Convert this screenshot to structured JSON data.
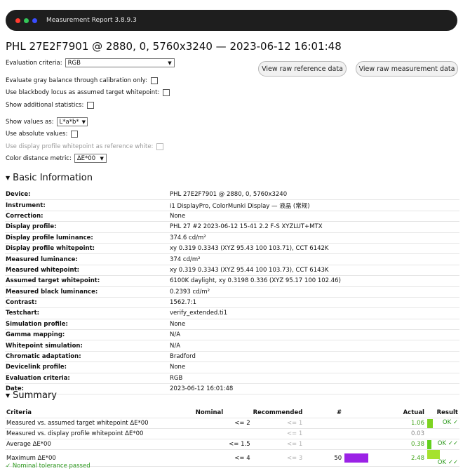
{
  "window": {
    "title": "Measurement Report 3.8.9.3",
    "controls": [
      {
        "name": "close",
        "color": "#ff3b30"
      },
      {
        "name": "minimize",
        "color": "#34c759"
      },
      {
        "name": "maximize",
        "color": "#3a4dff"
      }
    ]
  },
  "heading": "PHL 27E2F7901 @ 2880, 0, 5760x3240 — 2023-06-12 16:01:48",
  "buttons": {
    "raw_reference": "View raw reference data",
    "raw_measurement": "View raw measurement data"
  },
  "options": {
    "evaluation_criteria_label": "Evaluation criteria:",
    "evaluation_criteria_value": "RGB",
    "gray_balance_label": "Evaluate gray balance through calibration only:",
    "blackbody_label": "Use blackbody locus as assumed target whitepoint:",
    "additional_stats_label": "Show additional statistics:",
    "show_values_label": "Show values as:",
    "show_values_value": "L*a*b*",
    "absolute_values_label": "Use absolute values:",
    "display_profile_wp_label": "Use display profile whitepoint as reference white:",
    "color_distance_label": "Color distance metric:",
    "color_distance_value": "ΔE*00"
  },
  "basic_info": {
    "title": "Basic Information",
    "rows": [
      {
        "key": "Device:",
        "value": "PHL 27E2F7901 @ 2880, 0, 5760x3240"
      },
      {
        "key": "Instrument:",
        "value": "i1 DisplayPro, ColorMunki Display — 液晶 (常规)"
      },
      {
        "key": "Correction:",
        "value": "None"
      },
      {
        "key": "Display profile:",
        "value": "PHL 27 #2 2023-06-12 15-41 2.2 F-S XYZLUT+MTX"
      },
      {
        "key": "Display profile luminance:",
        "value": "374.6 cd/m²"
      },
      {
        "key": "Display profile whitepoint:",
        "value": "xy 0.319 0.3343 (XYZ 95.43 100 103.71), CCT 6142K"
      },
      {
        "key": "Measured luminance:",
        "value": "374 cd/m²"
      },
      {
        "key": "Measured whitepoint:",
        "value": "xy 0.319 0.3343 (XYZ 95.44 100 103.73), CCT 6143K"
      },
      {
        "key": "Assumed target whitepoint:",
        "value": "6100K daylight, xy 0.3198 0.336 (XYZ 95.17 100 102.46)"
      },
      {
        "key": "Measured black luminance:",
        "value": "0.2393 cd/m²"
      },
      {
        "key": "Contrast:",
        "value": "1562.7:1"
      },
      {
        "key": "Testchart:",
        "value": "verify_extended.ti1"
      },
      {
        "key": "Simulation profile:",
        "value": "None"
      },
      {
        "key": "Gamma mapping:",
        "value": "N/A"
      },
      {
        "key": "Whitepoint simulation:",
        "value": "N/A"
      },
      {
        "key": "Chromatic adaptation:",
        "value": "Bradford"
      },
      {
        "key": "Devicelink profile:",
        "value": "None"
      },
      {
        "key": "Evaluation criteria:",
        "value": "RGB"
      },
      {
        "key": "Date:",
        "value": "2023-06-12 16:01:48"
      }
    ]
  },
  "summary": {
    "title": "Summary",
    "headers": {
      "criteria": "Criteria",
      "nominal": "Nominal",
      "recommended": "Recommended",
      "count": "#",
      "actual": "Actual",
      "result": "Result"
    },
    "max_delta_for_bar": 2.48,
    "rows": [
      {
        "criteria": "Measured vs. assumed target whitepoint ΔE*00",
        "nominal": "<= 2",
        "recommended": "<= 1",
        "count": "",
        "count_bar_color": "",
        "actual": "1.06",
        "actual_value": 1.06,
        "actual_bar_color": "#7ed321",
        "result": "OK ✓"
      },
      {
        "criteria": "Measured vs. display profile whitepoint ΔE*00",
        "nominal": "",
        "recommended": "<= 1",
        "count": "",
        "count_bar_color": "",
        "actual": "0.03",
        "actual_value": 0.03,
        "actual_bar_color": "",
        "result": ""
      },
      {
        "criteria": "Average ΔE*00",
        "nominal": "<= 1.5",
        "recommended": "<= 1",
        "count": "",
        "count_bar_color": "",
        "actual": "0.38",
        "actual_value": 0.38,
        "actual_bar_color": "#63d11d",
        "result": "OK ✓✓"
      },
      {
        "criteria": "Maximum ΔE*00",
        "nominal": "<= 4",
        "recommended": "<= 3",
        "count": "50",
        "count_bar_color": "#9b22e6",
        "actual": "2.48",
        "actual_value": 2.48,
        "actual_bar_color": "#a6e22e",
        "result": "OK ✓✓"
      }
    ],
    "footnote": "✓ Nominal tolerance passed"
  }
}
